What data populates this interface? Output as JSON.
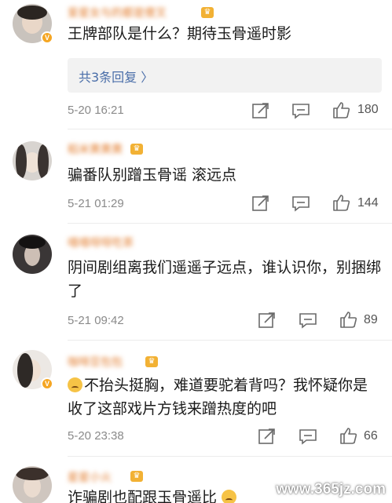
{
  "comments": [
    {
      "username": "爱星女与的都是傻叉",
      "text": "王牌部队是什么？期待玉骨遥时影",
      "reply_label": "共3条回复 〉",
      "date": "5-20 16:21",
      "likes": "180"
    },
    {
      "username": "稻米黄黄黄",
      "text": "骗番队别蹭玉骨谣 滚远点",
      "date": "5-21 01:29",
      "likes": "144"
    },
    {
      "username": "嘻嘻呀呀吃茶",
      "text": "阴间剧组离我们遥遥子远点，谁认识你，别捆绑了",
      "date": "5-21 09:42",
      "likes": "89"
    },
    {
      "username": "咖啡豆包包",
      "text": "不抬头挺胸，难道要驼着背吗？我怀疑你是收了这部戏片方钱来蹭热度的吧",
      "date": "5-20 23:38",
      "likes": "66"
    },
    {
      "username": "星星小火",
      "text": "诈骗剧也配跟玉骨遥比"
    }
  ],
  "icons": {
    "share": "share-icon",
    "comment": "comment-icon",
    "like": "thumbs-up-icon"
  },
  "colors": {
    "username": "#e27b2b",
    "reply_link": "#4a6ea9",
    "meta": "#8a8a8a"
  },
  "watermark": "www.365jz.com"
}
